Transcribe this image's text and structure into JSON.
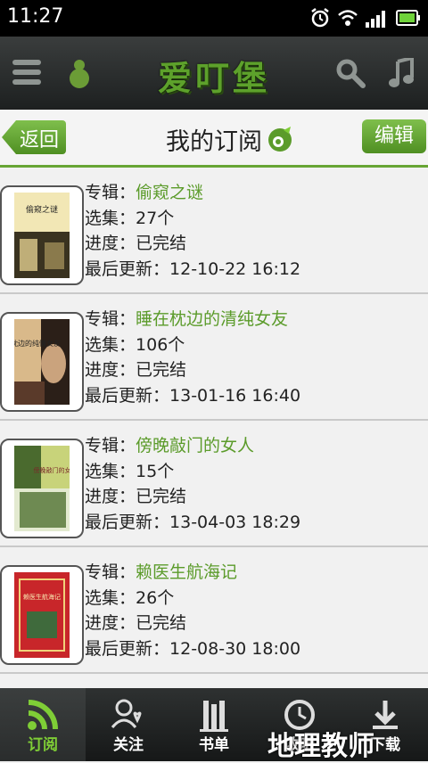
{
  "status": {
    "time": "11:27"
  },
  "app": {
    "logo": "爱叮堡"
  },
  "titlebar": {
    "back_label": "返回",
    "title": "我的订阅",
    "edit_label": "编辑"
  },
  "labels": {
    "album": "专辑：",
    "episodes": "选集：",
    "progress": "进度：",
    "updated": "最后更新："
  },
  "items": [
    {
      "album": "偷窥之谜",
      "episodes": "27个",
      "progress": "已完结",
      "updated": "12-10-22 16:12",
      "cover_text": "偷窥之谜"
    },
    {
      "album": "睡在枕边的清纯女友",
      "episodes": "106个",
      "progress": "已完结",
      "updated": "13-01-16 16:40",
      "cover_text": "睡在枕边的纯情女友"
    },
    {
      "album": "傍晚敲门的女人",
      "episodes": "15个",
      "progress": "已完结",
      "updated": "13-04-03 18:29",
      "cover_text": "傍晚敲门的女人"
    },
    {
      "album": "赖医生航海记",
      "episodes": "26个",
      "progress": "已完结",
      "updated": "12-08-30 18:00",
      "cover_text": "赖医生航海记"
    }
  ],
  "tabs": [
    {
      "label": "订阅"
    },
    {
      "label": "关注"
    },
    {
      "label": "书单"
    },
    {
      "label": "收听"
    },
    {
      "label": "下载"
    }
  ],
  "watermark": "地理教师",
  "colors": {
    "accent": "#5b9b2a",
    "header_bg": "#2a2d2d",
    "page_bg": "#f1f1f1"
  }
}
